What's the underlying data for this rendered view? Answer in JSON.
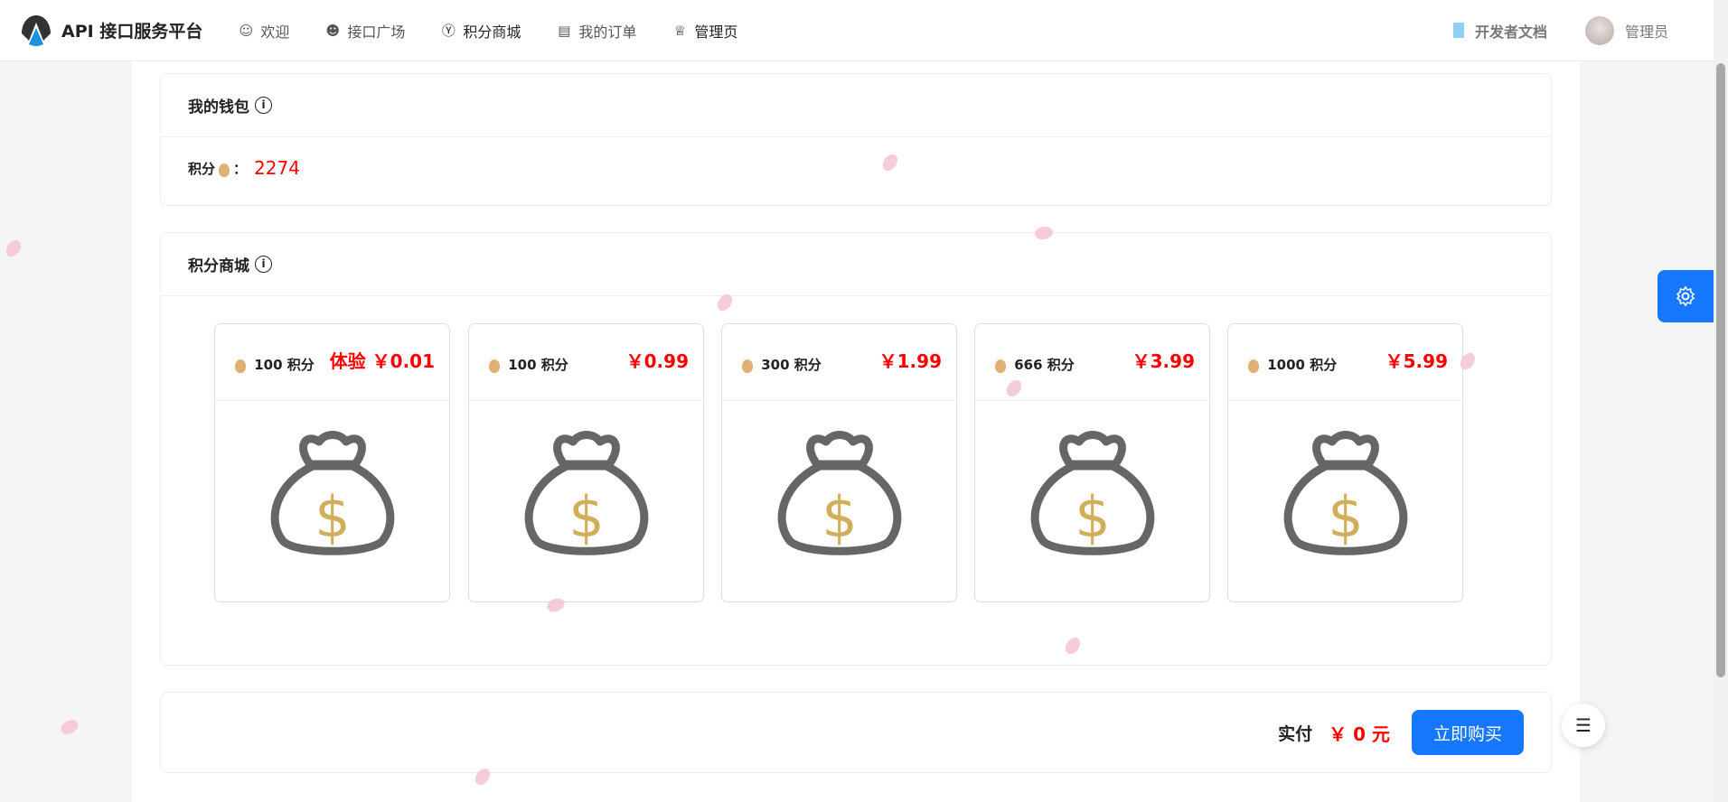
{
  "header": {
    "title": "API 接口服务平台",
    "nav": [
      {
        "label": "欢迎",
        "icon": "smile-icon"
      },
      {
        "label": "接口广场",
        "icon": "reddit-icon"
      },
      {
        "label": "积分商城",
        "icon": "yen-circle-icon"
      },
      {
        "label": "我的订单",
        "icon": "profile-icon"
      },
      {
        "label": "管理页",
        "icon": "crown-icon"
      }
    ],
    "docs": "开发者文档",
    "user": "管理员"
  },
  "wallet": {
    "title": "我的钱包",
    "points_label": "积分",
    "colon": "：",
    "points": "2274"
  },
  "shop": {
    "title": "积分商城",
    "products": [
      {
        "name": "100 积分",
        "price": "体验 ￥0.01"
      },
      {
        "name": "100 积分",
        "price": "￥0.99"
      },
      {
        "name": "300 积分",
        "price": "￥1.99"
      },
      {
        "name": "666 积分",
        "price": "￥3.99"
      },
      {
        "name": "1000 积分",
        "price": "￥5.99"
      }
    ]
  },
  "checkout": {
    "label": "实付",
    "amount": "￥ 0 元",
    "buy": "立即购买"
  },
  "colors": {
    "accent": "#1677ff",
    "price": "#ff0000"
  }
}
